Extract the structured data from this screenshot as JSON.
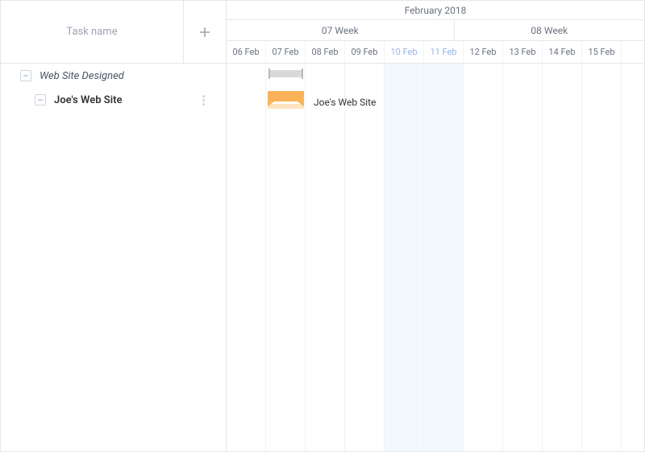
{
  "header": {
    "task_name_label": "Task name",
    "month_label": "February 2018",
    "weeks": [
      {
        "label": "07 Week",
        "span_days": 6
      },
      {
        "label": "08 Week",
        "span_days": 5
      }
    ],
    "days": [
      {
        "label": "06 Feb",
        "weekend": false
      },
      {
        "label": "07 Feb",
        "weekend": false
      },
      {
        "label": "08 Feb",
        "weekend": false
      },
      {
        "label": "09 Feb",
        "weekend": false
      },
      {
        "label": "10 Feb",
        "weekend": true
      },
      {
        "label": "11 Feb",
        "weekend": true
      },
      {
        "label": "12 Feb",
        "weekend": false
      },
      {
        "label": "13 Feb",
        "weekend": false
      },
      {
        "label": "14 Feb",
        "weekend": false
      },
      {
        "label": "15 Feb",
        "weekend": false
      }
    ]
  },
  "tasks": [
    {
      "name": "Web Site Designed",
      "type": "parent",
      "start_col": 1,
      "span": 1
    },
    {
      "name": "Joe's Web Site",
      "type": "child",
      "start_col": 1,
      "span": 1,
      "bar_label": "Joe's Web Site"
    }
  ],
  "colors": {
    "task_bar": "#f9b257",
    "task_bar_sub": "#fde3c0",
    "summary_bar": "#d7d9db",
    "weekend_bg": "#f3f8ff",
    "weekend_text": "#93b4e8"
  }
}
